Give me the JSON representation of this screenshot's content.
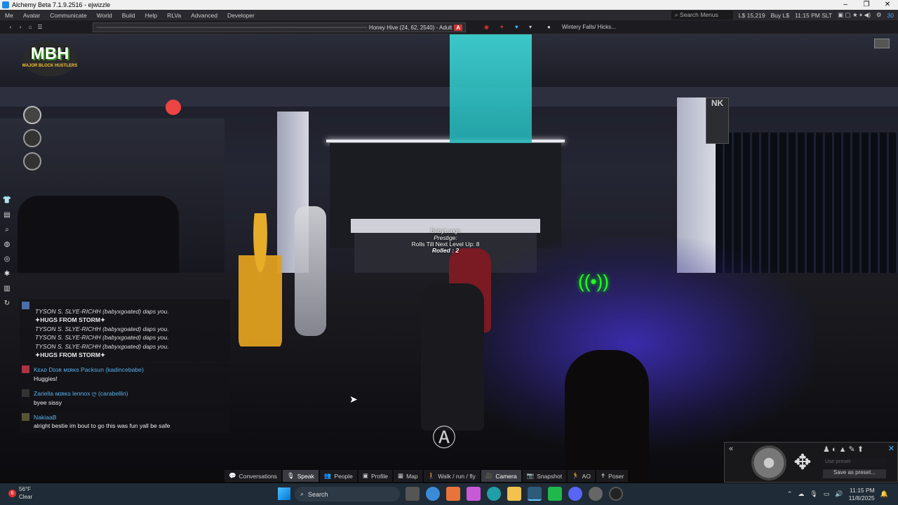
{
  "window": {
    "title": "Alchemy Beta 7.1.9.2516 - ejwizzle"
  },
  "menu": {
    "items": [
      "Me",
      "Avatar",
      "Communicate",
      "World",
      "Build",
      "Help",
      "RLVa",
      "Advanced",
      "Developer"
    ],
    "search_placeholder": "Search Menus",
    "balance": "L$ 15,219",
    "buy": "Buy L$",
    "time": "11:15 PM SLT",
    "fps": "30"
  },
  "location": {
    "region_text": "Honey Hive (24, 62, 2540) - Adult",
    "rating": "A",
    "parcel": "Wintery Falls/ Hicks..."
  },
  "hud": {
    "logo_top": "MBH",
    "logo_bottom": "MAJOR BLOCK HUSTLERS",
    "phone_label": "NK",
    "floating_title": "Rolls Till Next Level Up: 8",
    "floating_rolled": "Rolled : 2",
    "floating_prestige": "Prestige:",
    "floating_name": "BabyLungs"
  },
  "chat": [
    {
      "type": "emote",
      "lines": [
        "TYSON S. SLYE-RICHH (babyxgoated) daps you.",
        "✦HUGS FROM STORM✦",
        "TYSON S. SLYE-RICHH (babyxgoated) daps you.",
        "TYSON S. SLYE-RICHH (babyxgoated) daps you.",
        "TYSON S. SLYE-RICHH (babyxgoated) daps you.",
        "✦HUGS FROM STORM✦"
      ]
    },
    {
      "type": "msg",
      "name": "Kᴇᴀᴅ Dɪᴏʀ ᴍɪʀᴋs Packsun (kadincebabe)",
      "text": "Huggies!"
    },
    {
      "type": "msg",
      "name": "Zariella ᴍɪʀᴋs  lennox  ღ (carabellin)",
      "text": "byee sissy"
    },
    {
      "type": "msg",
      "name": "NakiaaB",
      "text": "alright bestie im bout to go this was fun yall be safe"
    }
  ],
  "bottombar": [
    "Conversations",
    "Speak",
    "People",
    "Profile",
    "Map",
    "Walk / run / fly",
    "Camera",
    "Snapshot",
    "AO",
    "Poser"
  ],
  "camera": {
    "preset_placeholder": "Use preset",
    "save_preset": "Save as preset..."
  },
  "taskbar": {
    "weather_temp": "56°F",
    "weather_desc": "Clear",
    "weather_badge": "6",
    "search": "Search",
    "time": "11:15 PM",
    "date": "11/8/2025"
  }
}
